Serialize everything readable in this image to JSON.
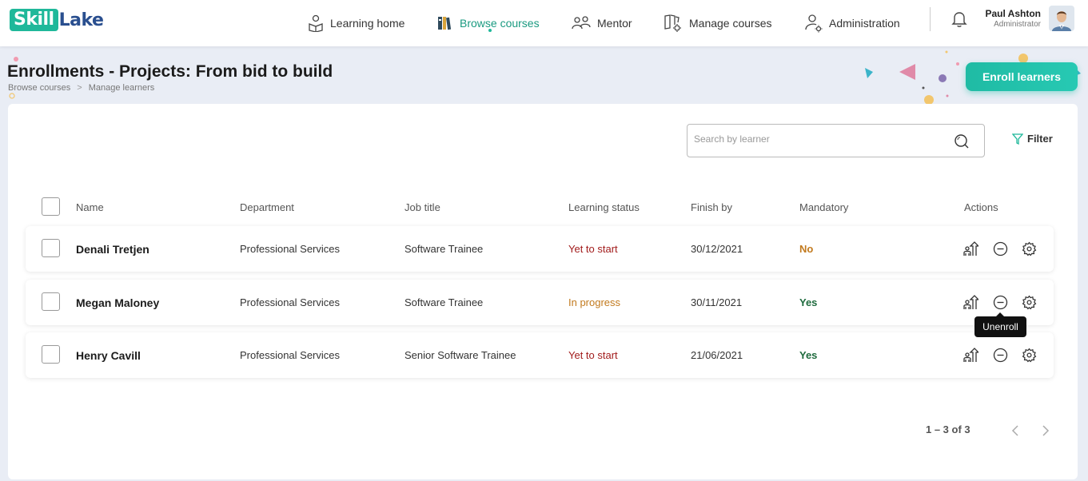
{
  "app": {
    "logo_left": "Skill",
    "logo_right": "Lake"
  },
  "nav": {
    "items": [
      {
        "label": "Learning home",
        "icon": "learning-home-icon"
      },
      {
        "label": "Browse courses",
        "icon": "books-icon",
        "active": true
      },
      {
        "label": "Mentor",
        "icon": "mentor-icon"
      },
      {
        "label": "Manage courses",
        "icon": "manage-courses-icon"
      },
      {
        "label": "Administration",
        "icon": "administration-icon"
      }
    ]
  },
  "user": {
    "name": "Paul Ashton",
    "role": "Administrator"
  },
  "page": {
    "title": "Enrollments - Projects: From bid to build",
    "breadcrumb": [
      "Browse courses",
      "Manage learners"
    ],
    "breadcrumb_sep": ">",
    "enroll_label": "Enroll learners"
  },
  "search": {
    "placeholder": "Search by learner",
    "value": ""
  },
  "filter_label": "Filter",
  "table": {
    "columns": [
      "Name",
      "Department",
      "Job title",
      "Learning status",
      "Finish by",
      "Mandatory",
      "Actions"
    ],
    "rows": [
      {
        "name": "Denali Tretjen",
        "department": "Professional Services",
        "job_title": "Software Trainee",
        "status": "Yet to start",
        "finish_by": "30/12/2021",
        "mandatory": "No"
      },
      {
        "name": "Megan Maloney",
        "department": "Professional Services",
        "job_title": "Software Trainee",
        "status": "In progress",
        "finish_by": "30/11/2021",
        "mandatory": "Yes"
      },
      {
        "name": "Henry Cavill",
        "department": "Professional Services",
        "job_title": "Senior Software Trainee",
        "status": "Yet to start",
        "finish_by": "21/06/2021",
        "mandatory": "Yes"
      }
    ]
  },
  "tooltip": "Unenroll",
  "pagination": {
    "range": "1 – 3 of 3"
  },
  "colors": {
    "accent": "#1fb89a",
    "status_yet": "#a21c1c",
    "status_progress": "#c27a1e",
    "mandatory_yes": "#1f6b3e"
  }
}
